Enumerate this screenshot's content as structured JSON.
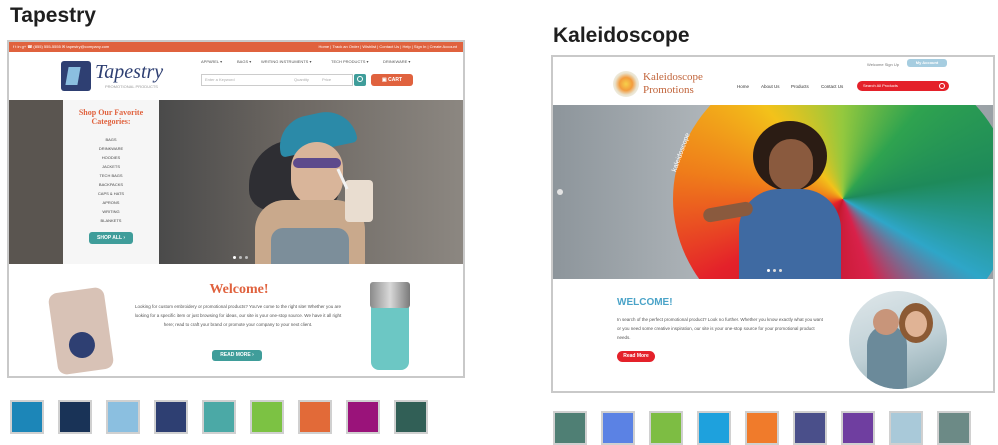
{
  "colors": {
    "tapestry_accent": "#e0623e",
    "tapestry_teal": "#3f9d9a",
    "kaleidoscope_red": "#e4212a",
    "kaleidoscope_blue": "#4aa3c8"
  },
  "tapestry": {
    "heading": "Tapestry",
    "topbar_left": "f  t  in  g+  ☎ (855) 555-5555  ✉ tapestry@company.com",
    "topbar_right": "Home  |  Track an Order  |  Wishlist  |  Contact Us  |  Help  |  Sign In  |  Create Account",
    "logo_text": "Tapestry",
    "logo_tagline": "PROMOTIONAL PRODUCTS",
    "nav_items": [
      "APPAREL ▾",
      "BAGS ▾",
      "WRITING INSTRUMENTS ▾",
      "TECH PRODUCTS ▾",
      "DRINKWARE ▾"
    ],
    "search_placeholder": "Enter a Keyword",
    "search_extra": [
      "Quantity",
      "Price"
    ],
    "cart_label": "▣ CART",
    "sidebar_title": "Shop Our Favorite Categories:",
    "categories": [
      "BAGS",
      "DRINKWARE",
      "HOODIES",
      "JACKETS",
      "TECH BAGS",
      "BACKPACKS",
      "CAPS & HATS",
      "APRONS",
      "WRITING",
      "BLANKETS"
    ],
    "shop_all": "SHOP ALL ›",
    "welcome_title": "Welcome!",
    "welcome_text": "Looking for custom embroidery or promotional products? You've come to the right site! Whether you are looking for a specific item or just browsing for ideas, our site is your one-stop source. We have it all right here; read to craft your brand or promote your company to your next client.",
    "read_more": "READ MORE ›",
    "swatches": [
      "#1c86b8",
      "#193357",
      "#8bbfe0",
      "#2e3f72",
      "#4ba9a6",
      "#7cc243",
      "#e26a38",
      "#9a137a",
      "#315f56"
    ]
  },
  "kaleidoscope": {
    "heading": "Kaleidoscope",
    "top_links": "Welcome  Sign Up",
    "top_button": "My Account",
    "logo_line1": "Kaleidoscope",
    "logo_line2": "Promotions",
    "nav_items": [
      "Home",
      "About Us",
      "Products",
      "Contact Us"
    ],
    "search_placeholder": "Search All Products",
    "umbrella_text": "kaleidoscope",
    "welcome_title": "WELCOME!",
    "welcome_text": "In search of the perfect promotional product? Look no further. Whether you know exactly what you want or you need some creative inspiration, our site is your one-stop source for your promotional product needs.",
    "read_more": "Read More",
    "swatches": [
      "#4f7f74",
      "#5b82e4",
      "#7dbd43",
      "#1ea1dd",
      "#f07b2b",
      "#4a4f8a",
      "#6f3ea0",
      "#a9c9d9",
      "#6c8a86"
    ]
  }
}
